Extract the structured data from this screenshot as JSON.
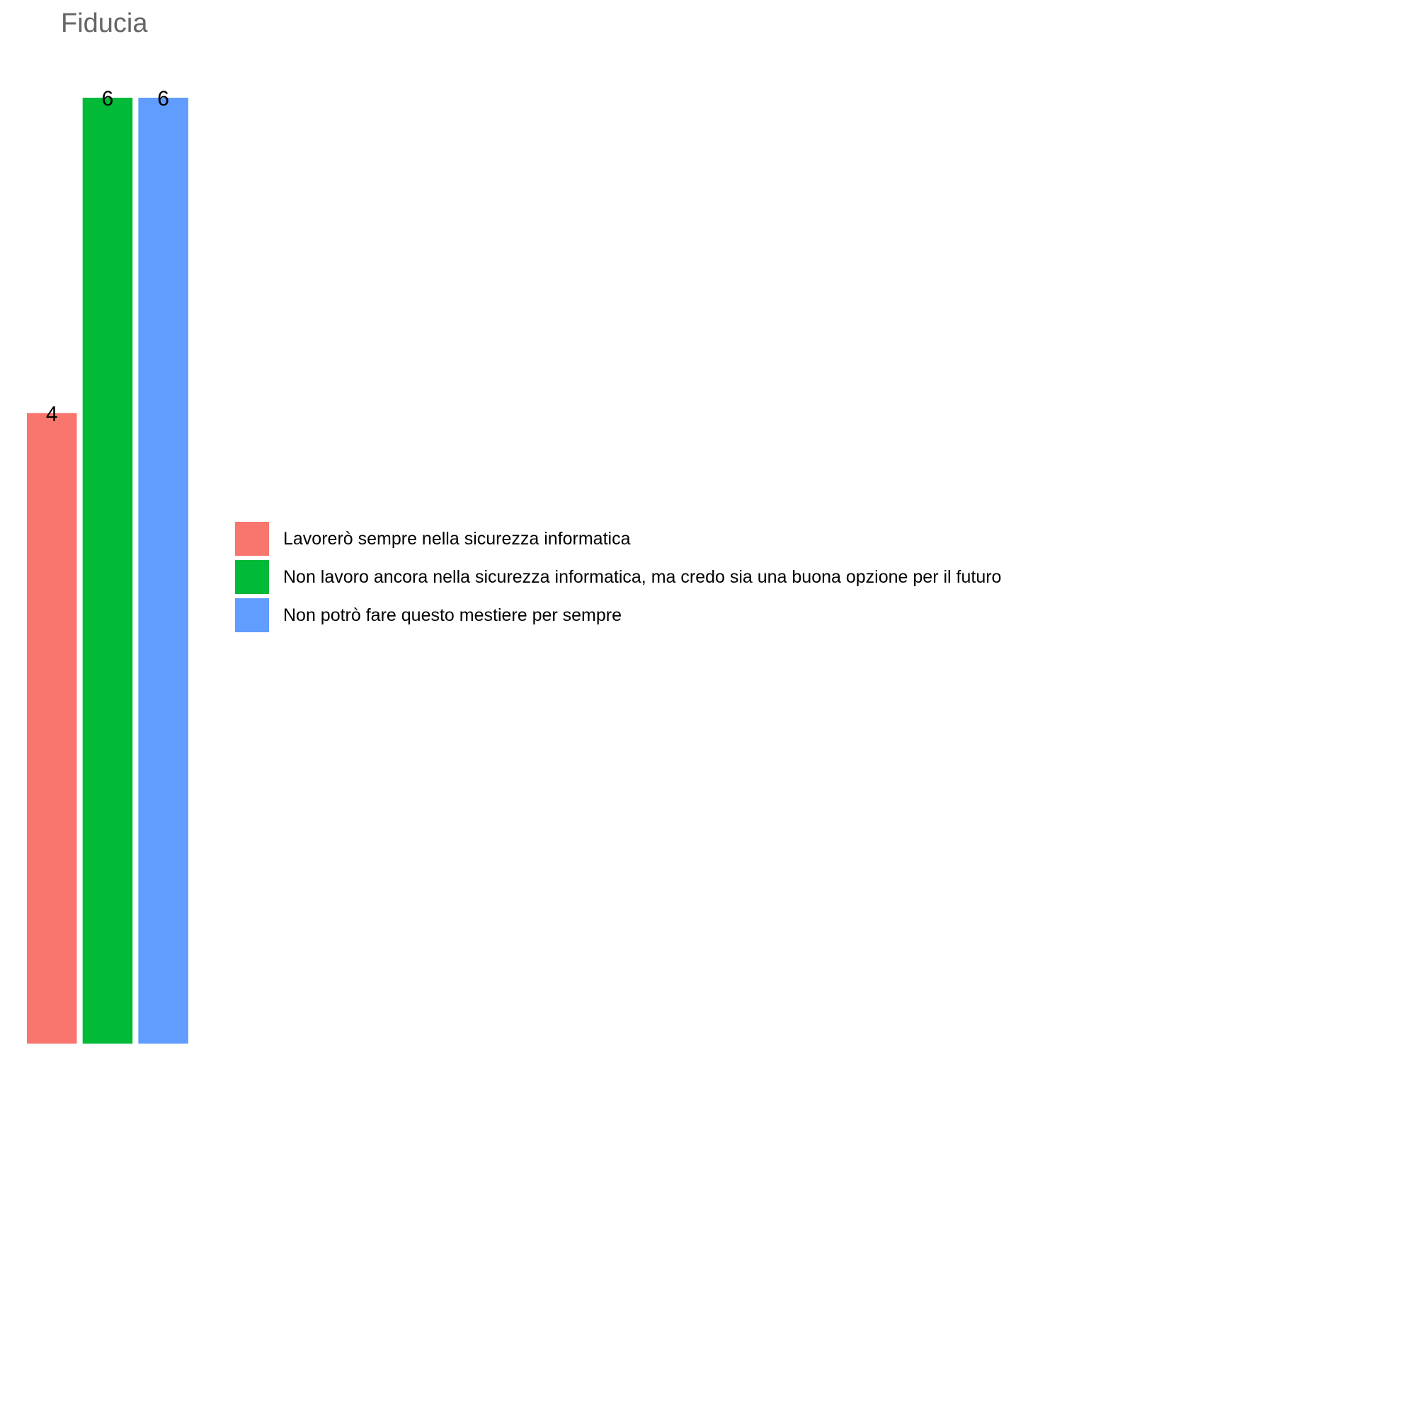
{
  "chart_data": {
    "type": "bar",
    "title": "Fiducia",
    "categories": [
      "Lavorerò sempre nella sicurezza informatica",
      "Non lavoro ancora nella sicurezza informatica, ma credo sia una buona opzione per il futuro",
      "Non potrò fare questo mestiere per sempre"
    ],
    "values": [
      4,
      6,
      6
    ],
    "data_labels": [
      "4",
      "6",
      "6"
    ],
    "colors": [
      "#F8766D",
      "#00BA38",
      "#619CFF"
    ],
    "ylim": [
      0,
      6
    ],
    "grid": false,
    "axes_visible": false,
    "legend_position": "right"
  }
}
